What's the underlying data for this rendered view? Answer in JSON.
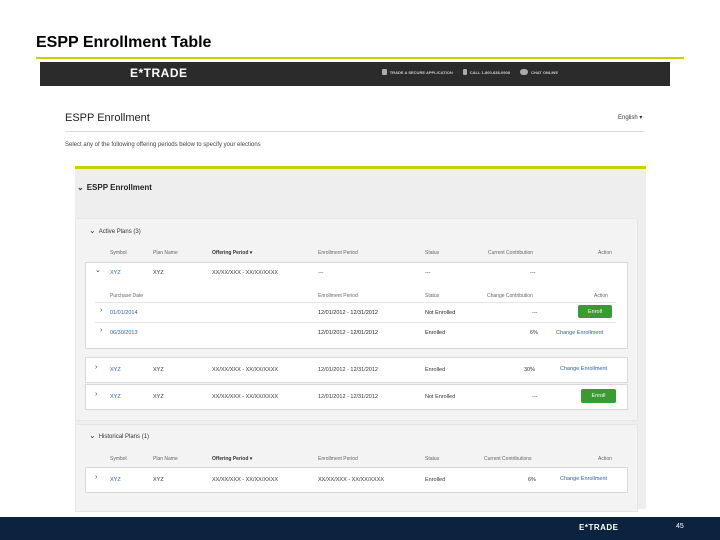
{
  "slide": {
    "title": "ESPP Enrollment Table",
    "page_number": "45",
    "footer_logo": "E*TRADE"
  },
  "topbar": {
    "logo": "E*TRADE",
    "secure": "TRADE A SECURE APPLICATION",
    "call": "CALL 1-800-838-0908",
    "chat": "CHAT ONLINE"
  },
  "page": {
    "heading": "ESPP Enrollment",
    "language": "English",
    "language_caret": "▾",
    "instructions": "Select any of the following offering periods below to specify your elections",
    "panel_title": "ESPP Enrollment"
  },
  "active_plans": {
    "label": "Active Plans (3)",
    "headers": {
      "symbol": "Symbol",
      "plan_name": "Plan Name",
      "offering_period": "Offering Period ▾",
      "enrollment_period": "Enrollment Period",
      "status": "Status",
      "current_contribution": "Current Contribution",
      "action": "Action"
    },
    "expanded": {
      "symbol": "XYZ",
      "plan_name": "XYZ",
      "offering_period": "XX/XX/XXX - XX/XX/XXXX",
      "enrollment_period": "---",
      "status": "---",
      "contribution": "---",
      "sub_headers": {
        "purchase_date": "Purchase Date",
        "enrollment_period": "Enrollment Period",
        "status": "Status",
        "contribution": "Change Contribution",
        "action": "Action"
      },
      "sub_rows": [
        {
          "purchase_date": "01/01/2014",
          "enrollment_period": "12/01/2012 - 12/31/2012",
          "status": "Not Enrolled",
          "contribution": "---",
          "action": "Enroll",
          "action_type": "button"
        },
        {
          "purchase_date": "06/30/2013",
          "enrollment_period": "12/01/2012 - 12/01/2012",
          "status": "Enrolled",
          "contribution": "6%",
          "action": "Change Enrollment",
          "action_type": "link"
        }
      ]
    },
    "rows": [
      {
        "symbol": "XYZ",
        "plan_name": "XYZ",
        "offering_period": "XX/XX/XXX - XX/XX/XXXX",
        "enrollment_period": "12/01/2012 - 12/31/2012",
        "status": "Enrolled",
        "contribution": "30%",
        "action": "Change Enrollment",
        "action_type": "link"
      },
      {
        "symbol": "XYZ",
        "plan_name": "XYZ",
        "offering_period": "XX/XX/XXX - XX/XX/XXXX",
        "enrollment_period": "12/01/2012 - 12/31/2012",
        "status": "Not Enrolled",
        "contribution": "---",
        "action": "Enroll",
        "action_type": "button"
      }
    ]
  },
  "historical_plans": {
    "label": "Historical Plans (1)",
    "headers": {
      "symbol": "Symbol",
      "plan_name": "Plan Name",
      "offering_period": "Offering Period ▾",
      "enrollment_period": "Enrollment Period",
      "status": "Status",
      "current_contribution": "Current Contributions",
      "action": "Action"
    },
    "rows": [
      {
        "symbol": "XYZ",
        "plan_name": "XYZ",
        "offering_period": "XX/XX/XXX - XX/XX/XXXX",
        "enrollment_period": "XX/XX/XXX - XX/XX/XXXX",
        "status": "Enrolled",
        "contribution": "6%",
        "action": "Change Enrollment",
        "action_type": "link"
      }
    ]
  },
  "colors": {
    "accent": "#c9d200",
    "enroll_button": "#3a9a33",
    "link": "#2d5ea8",
    "footer": "#0c2340",
    "topbar": "#2b2b2b"
  }
}
